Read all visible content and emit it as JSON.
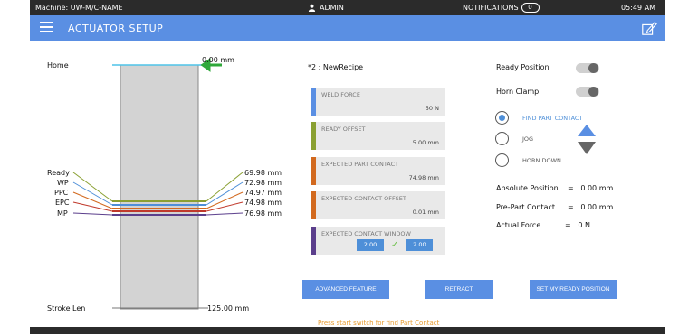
{
  "status_bar": {
    "machine": "Machine: UW-M/C-NAME",
    "user": "ADMIN",
    "notifications_label": "NOTIFICATIONS",
    "notifications_count": "0",
    "time": "05:49 AM"
  },
  "header": {
    "title": "ACTUATOR SETUP"
  },
  "diagram": {
    "home_label": "Home",
    "home_value": "0.00 mm",
    "stroke_label": "Stroke Len",
    "stroke_value": "125.00 mm",
    "positions": [
      {
        "label": "Ready",
        "value": "69.98 mm",
        "color": "#8aa032"
      },
      {
        "label": "WP",
        "value": "72.98 mm",
        "color": "#4e8fd8"
      },
      {
        "label": "PPC",
        "value": "74.97 mm",
        "color": "#d2691e"
      },
      {
        "label": "EPC",
        "value": "74.98 mm",
        "color": "#c0392b"
      },
      {
        "label": "MP",
        "value": "76.98 mm",
        "color": "#5b3f8c"
      }
    ]
  },
  "recipe": {
    "name": "*2 : NewRecipe",
    "cards": [
      {
        "title": "WELD FORCE",
        "value": "50 N",
        "color": "#5a8fe3"
      },
      {
        "title": "READY OFFSET",
        "value": "5.00 mm",
        "color": "#8aa032"
      },
      {
        "title": "EXPECTED PART CONTACT",
        "value": "74.98 mm",
        "color": "#d2691e"
      },
      {
        "title": "EXPECTED CONTACT OFFSET",
        "value": "0.01 mm",
        "color": "#d2691e"
      },
      {
        "title": "EXPECTED CONTACT WINDOW",
        "low": "2.00",
        "high": "2.00",
        "color": "#5b3f8c"
      }
    ]
  },
  "right_panel": {
    "ready_position": "Ready Position",
    "horn_clamp": "Horn Clamp",
    "options": [
      "FIND PART CONTACT",
      "JOG",
      "HORN DOWN"
    ],
    "selected_option": "FIND PART CONTACT",
    "absolute_position_label": "Absolute Position",
    "absolute_position_value": "=   0.00 mm",
    "pre_part_contact_label": "Pre-Part Contact",
    "pre_part_contact_value": "=   0.00 mm",
    "actual_force_label": "Actual Force",
    "actual_force_value": "=   0 N"
  },
  "buttons": {
    "advanced": "ADVANCED FEATURE",
    "retract": "RETRACT",
    "set_ready": "SET MY READY POSITION"
  },
  "hint": "Press start switch for find Part Contact",
  "colors": {
    "accent": "#5a8fe3",
    "status_bar": "#2b2b2b",
    "hint": "#e69a2e"
  }
}
